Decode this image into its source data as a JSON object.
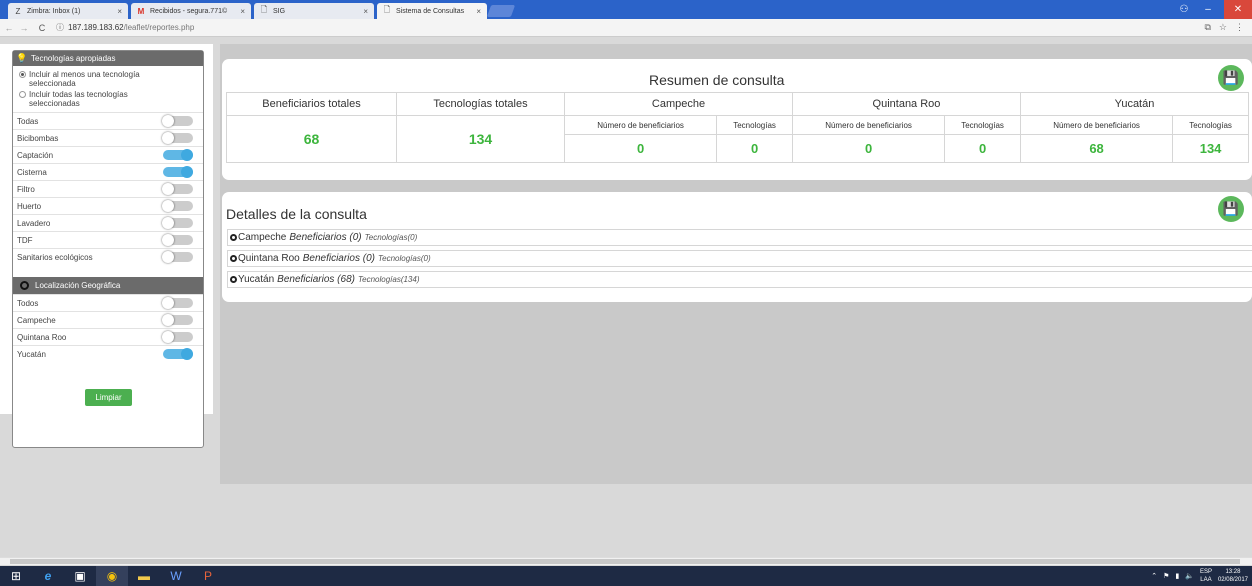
{
  "browser": {
    "tabs": [
      {
        "title": "Zimbra: Inbox (1)",
        "icon": "zimbra-icon"
      },
      {
        "title": "Recibidos - segura.771©",
        "icon": "gmail-icon"
      },
      {
        "title": "SIG",
        "icon": "page-icon"
      },
      {
        "title": "Sistema de Consultas",
        "icon": "page-icon"
      }
    ],
    "url_host": "187.189.183.62",
    "url_path": "/leaflet/reportes.php"
  },
  "filters": {
    "tech_header": "Tecnologías apropiadas",
    "radio_any": "Incluir al menos una tecnología seleccionada",
    "radio_all": "Incluir todas las tecnologías seleccionadas",
    "technologies": [
      {
        "label": "Todas",
        "on": false
      },
      {
        "label": "Bicibombas",
        "on": false
      },
      {
        "label": "Captación",
        "on": true
      },
      {
        "label": "Cisterna",
        "on": true
      },
      {
        "label": "Filtro",
        "on": false
      },
      {
        "label": "Huerto",
        "on": false
      },
      {
        "label": "Lavadero",
        "on": false
      },
      {
        "label": "TDF",
        "on": false
      },
      {
        "label": "Sanitarios ecológicos",
        "on": false
      }
    ],
    "geo_header": "Localización Geográfica",
    "locations": [
      {
        "label": "Todos",
        "on": false
      },
      {
        "label": "Campeche",
        "on": false
      },
      {
        "label": "Quintana Roo",
        "on": false
      },
      {
        "label": "Yucatán",
        "on": true
      }
    ],
    "clear_label": "Limpiar"
  },
  "summary": {
    "title": "Resumen de consulta",
    "total_beneficiaries_label": "Beneficiarios totales",
    "total_technologies_label": "Tecnologías totales",
    "total_beneficiaries": "68",
    "total_technologies": "134",
    "sub_beneficiaries": "Número de beneficiarios",
    "sub_technologies": "Tecnologías",
    "states": [
      {
        "name": "Campeche",
        "beneficiaries": "0",
        "technologies": "0"
      },
      {
        "name": "Quintana Roo",
        "beneficiaries": "0",
        "technologies": "0"
      },
      {
        "name": "Yucatán",
        "beneficiaries": "68",
        "technologies": "134"
      }
    ]
  },
  "details": {
    "title": "Detalles de la consulta",
    "rows": [
      {
        "state": "Campeche",
        "ben": "Beneficiarios (0)",
        "tec": "Tecnologías(0)"
      },
      {
        "state": "Quintana Roo",
        "ben": "Beneficiarios (0)",
        "tec": "Tecnologías(0)"
      },
      {
        "state": "Yucatán",
        "ben": "Beneficiarios (68)",
        "tec": "Tecnologías(134)"
      }
    ]
  },
  "taskbar": {
    "lang_top": "ESP",
    "lang_bottom": "LAA",
    "time": "13:28",
    "date": "02/08/2017"
  },
  "colors": {
    "accent_green": "#3db53d",
    "button_green": "#4caf50",
    "toggle_on": "#3fa9e0",
    "tab_strip": "#2b63c9"
  }
}
